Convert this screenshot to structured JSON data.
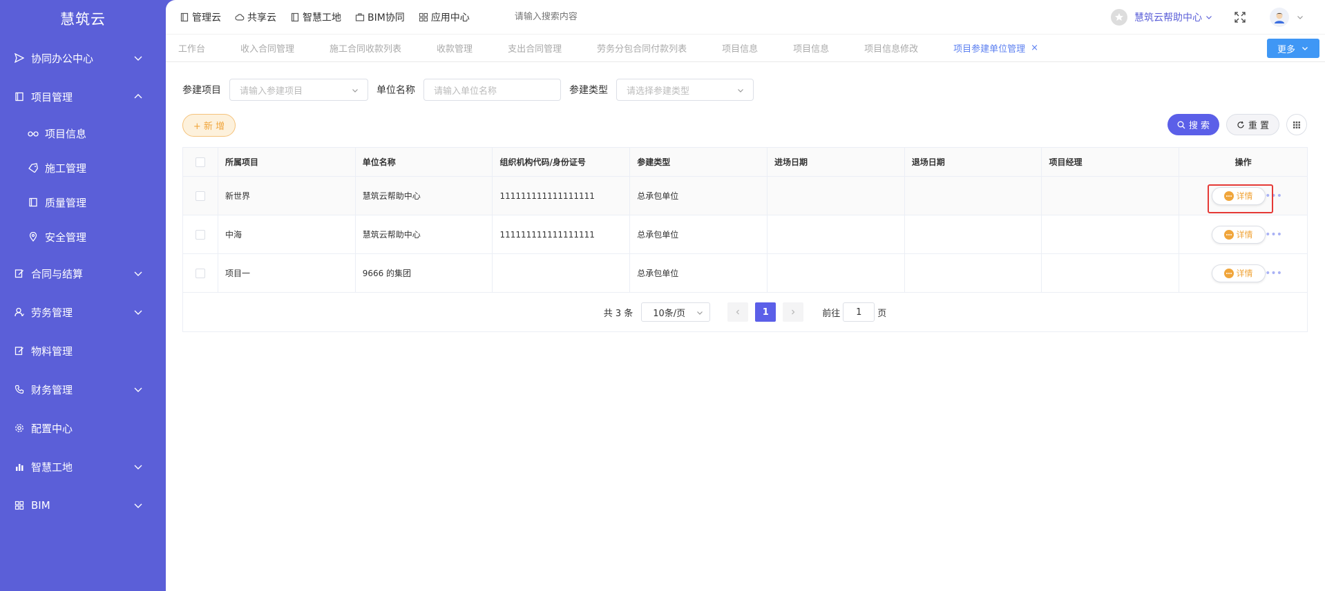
{
  "app": {
    "logo": "慧筑云"
  },
  "sidebar": {
    "items": [
      {
        "label": "协同办公中心",
        "icon": "send-icon",
        "expanded": false
      },
      {
        "label": "项目管理",
        "icon": "book-icon",
        "expanded": true,
        "children": [
          {
            "label": "项目信息",
            "icon": "glasses-icon"
          },
          {
            "label": "施工管理",
            "icon": "tag-icon"
          },
          {
            "label": "质量管理",
            "icon": "book-icon"
          },
          {
            "label": "安全管理",
            "icon": "location-icon"
          }
        ]
      },
      {
        "label": "合同与结算",
        "icon": "edit-icon",
        "expanded": false
      },
      {
        "label": "劳务管理",
        "icon": "user-icon",
        "expanded": false
      },
      {
        "label": "物料管理",
        "icon": "edit-icon",
        "expanded": null
      },
      {
        "label": "财务管理",
        "icon": "phone-icon",
        "expanded": false
      },
      {
        "label": "配置中心",
        "icon": "gear-icon",
        "expanded": null
      },
      {
        "label": "智慧工地",
        "icon": "bar-chart-icon",
        "expanded": false
      },
      {
        "label": "BIM",
        "icon": "grid-icon",
        "expanded": false
      }
    ]
  },
  "topnav": {
    "items": [
      "管理云",
      "共享云",
      "智慧工地",
      "BIM协同",
      "应用中心"
    ],
    "search_placeholder": "请输入搜索内容",
    "help_center": "慧筑云帮助中心"
  },
  "tabs": {
    "items": [
      "工作台",
      "收入合同管理",
      "施工合同收款列表",
      "收款管理",
      "支出合同管理",
      "劳务分包合同付款列表",
      "项目信息",
      "项目信息",
      "项目信息修改",
      "项目参建单位管理"
    ],
    "active_index": 9,
    "more": "更多"
  },
  "filter": {
    "project_label": "参建项目",
    "project_placeholder": "请输入参建项目",
    "unit_label": "单位名称",
    "unit_placeholder": "请输入单位名称",
    "type_label": "参建类型",
    "type_placeholder": "请选择参建类型"
  },
  "toolbar": {
    "add": "+ 新 增",
    "search": "搜 索",
    "reset": "重 置"
  },
  "table": {
    "columns": [
      "所属项目",
      "单位名称",
      "组织机构代码/身份证号",
      "参建类型",
      "进场日期",
      "退场日期",
      "项目经理",
      "操作"
    ],
    "rows": [
      {
        "project": "新世界",
        "unit": "慧筑云帮助中心",
        "code": "111111111111111111",
        "type": "总承包单位",
        "enter": "",
        "exit": "",
        "manager": ""
      },
      {
        "project": "中海",
        "unit": "慧筑云帮助中心",
        "code": "111111111111111111",
        "type": "总承包单位",
        "enter": "",
        "exit": "",
        "manager": ""
      },
      {
        "project": "项目一",
        "unit": "9666 的集团",
        "code": "",
        "type": "总承包单位",
        "enter": "",
        "exit": "",
        "manager": ""
      }
    ],
    "detail_label": "详情",
    "more_label": "•••"
  },
  "pagination": {
    "total": "共 3 条",
    "page_size": "10条/页",
    "current": "1",
    "goto_prefix": "前往",
    "goto_value": "1",
    "goto_suffix": "页"
  },
  "colors": {
    "sidebar": "#5b5fd8",
    "accent": "#5b5fe8",
    "orange": "#f0a53b",
    "highlight": "#e53935"
  }
}
